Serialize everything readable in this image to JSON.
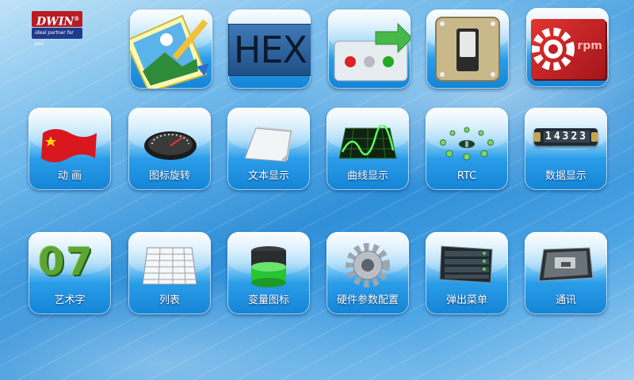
{
  "brand": {
    "name": "DWIN",
    "tagline": "ideal partner for you"
  },
  "top_row": [
    {
      "id": "picture",
      "icon": "picture-frame-icon"
    },
    {
      "id": "hex",
      "icon": "hex-text-icon",
      "text": "HEX"
    },
    {
      "id": "indicator",
      "icon": "indicator-lights-icon"
    },
    {
      "id": "switch",
      "icon": "toggle-switch-icon"
    },
    {
      "id": "rpm",
      "icon": "rpm-gear-icon",
      "text": "rpm"
    }
  ],
  "menu": [
    {
      "id": "animation",
      "label": "动  画",
      "icon": "flag-icon"
    },
    {
      "id": "icon-rotate",
      "label": "图标旋转",
      "icon": "gauge-icon"
    },
    {
      "id": "text-display",
      "label": "文本显示",
      "icon": "paper-stack-icon"
    },
    {
      "id": "curve-display",
      "label": "曲线显示",
      "icon": "curve-graph-icon"
    },
    {
      "id": "rtc",
      "label": "RTC",
      "icon": "clock-ring-icon"
    },
    {
      "id": "data-display",
      "label": "数据显示",
      "icon": "digit-counter-icon",
      "digits": "14323"
    },
    {
      "id": "art-font",
      "label": "艺术字",
      "icon": "grass-digits-icon",
      "digits": "07"
    },
    {
      "id": "list",
      "label": "列表",
      "icon": "table-sheet-icon"
    },
    {
      "id": "variable-icon",
      "label": "变量图标",
      "icon": "battery-level-icon"
    },
    {
      "id": "hardware-config",
      "label": "硬件参数配置",
      "icon": "gear-icon"
    },
    {
      "id": "popup-menu",
      "label": "弹出菜单",
      "icon": "popup-menu-icon"
    },
    {
      "id": "communication",
      "label": "通讯",
      "icon": "device-photo-icon"
    }
  ]
}
